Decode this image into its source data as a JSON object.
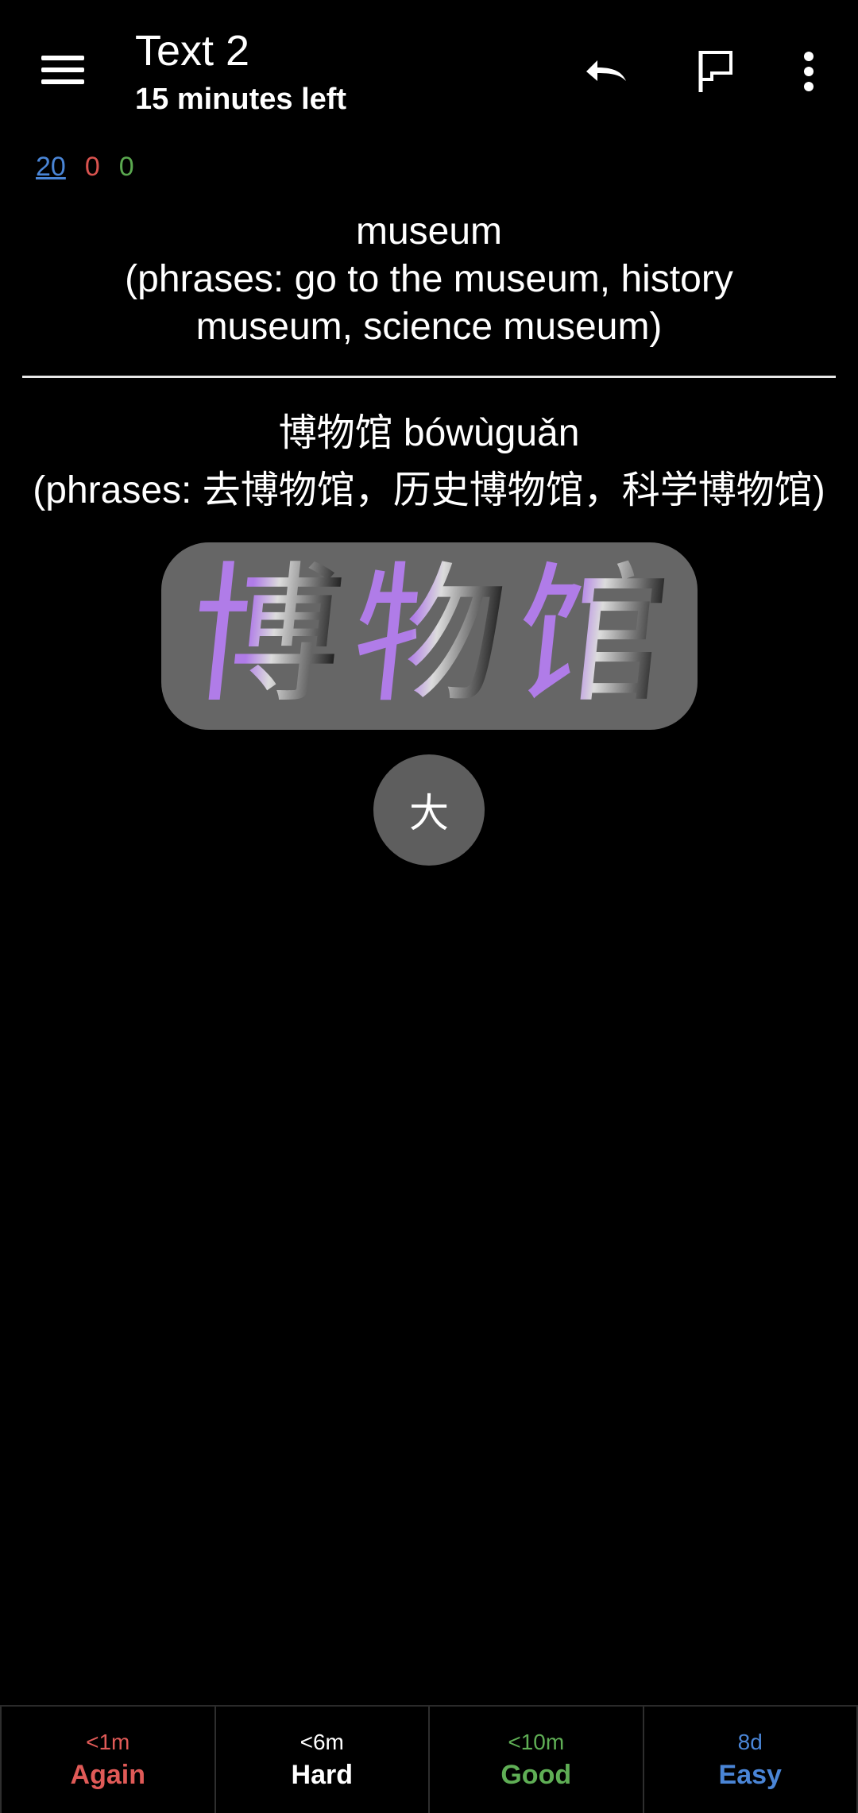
{
  "toolbar": {
    "title": "Text 2",
    "subtitle": "15 minutes left",
    "icons": [
      "menu-icon",
      "undo-icon",
      "flag-icon",
      "more-vert-icon"
    ]
  },
  "counts": {
    "new": "20",
    "learning": "0",
    "review": "0",
    "colors": {
      "new": "#4a85d6",
      "learning": "#d9534f",
      "review": "#5aa84f"
    }
  },
  "card": {
    "question_word": "museum",
    "question_phrases": "(phrases: go to the museum, history museum, science museum)",
    "answer_line": "博物馆 bówùguǎn",
    "answer_phrases": "(phrases: 去博物馆，历史博物馆，科学博物馆)",
    "hanzi": [
      "博",
      "物",
      "馆"
    ],
    "enlarge_button": "大"
  },
  "answer_buttons": [
    {
      "time": "<1m",
      "label": "Again",
      "color": "#e05a57"
    },
    {
      "time": "<6m",
      "label": "Hard",
      "color": "#ffffff"
    },
    {
      "time": "<10m",
      "label": "Good",
      "color": "#5fae55"
    },
    {
      "time": "8d",
      "label": "Easy",
      "color": "#4a85d6"
    }
  ]
}
